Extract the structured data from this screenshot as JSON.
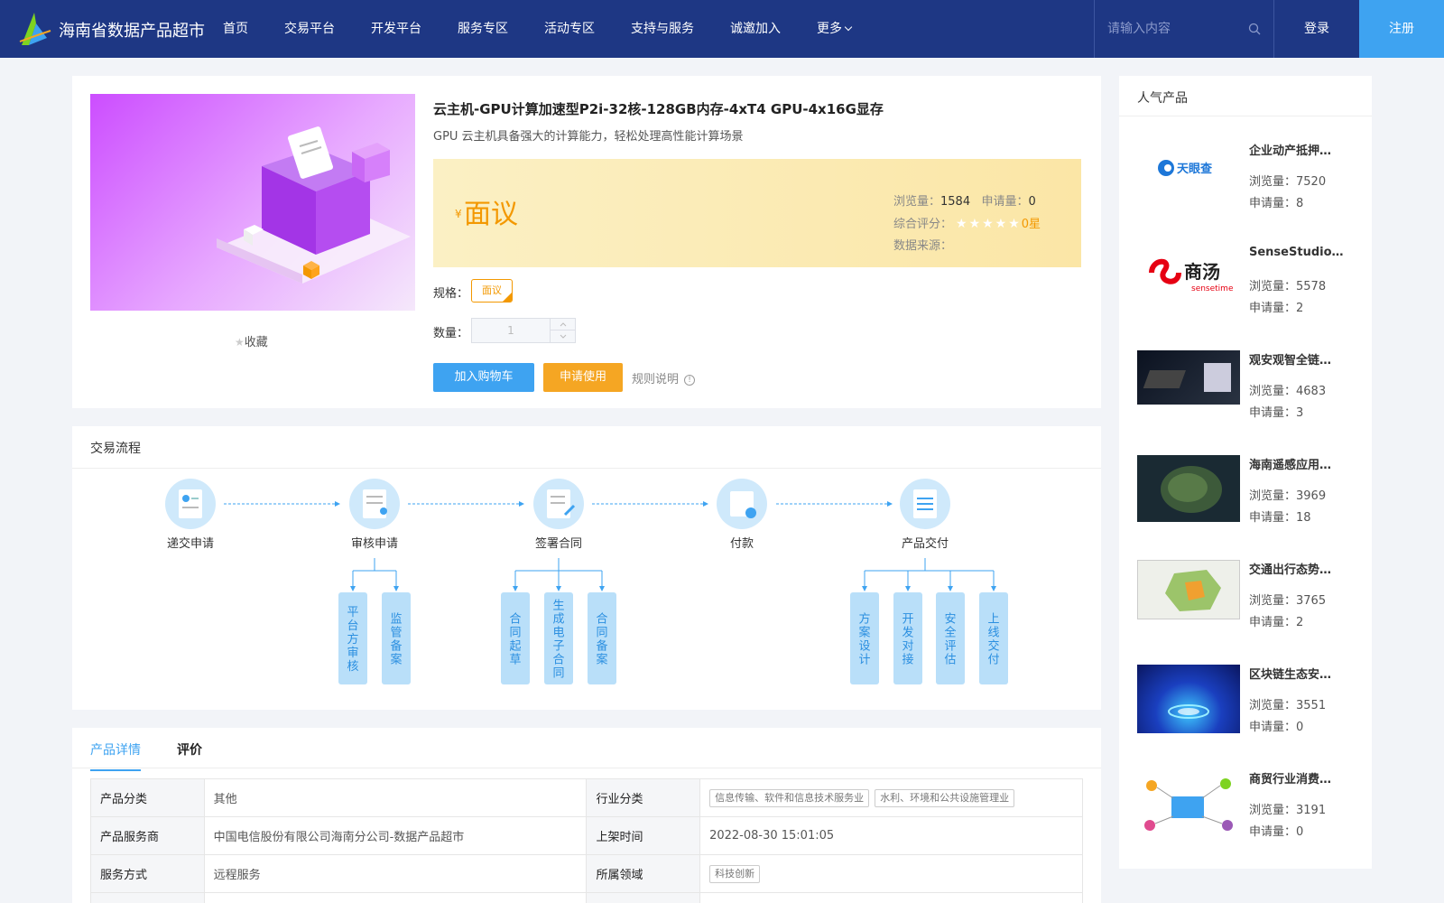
{
  "header": {
    "site_name": "海南省数据产品超市",
    "nav": [
      "首页",
      "交易平台",
      "开发平台",
      "服务专区",
      "活动专区",
      "支持与服务",
      "诚邀加入",
      "更多"
    ],
    "search_placeholder": "请输入内容",
    "login": "登录",
    "register": "注册"
  },
  "product": {
    "title": "云主机-GPU计算加速型P2i-32核-128GB内存-4xT4 GPU-4x16G显存",
    "subtitle": "GPU 云主机具备强大的计算能力，轻松处理高性能计算场景",
    "favorite": "收藏",
    "price_symbol": "¥",
    "price": "面议",
    "views_label": "浏览量：",
    "views": "1584",
    "applies_label": "申请量：",
    "applies": "0",
    "rating_label": "综合评分：",
    "rating": "0星",
    "source_label": "数据来源：",
    "spec_label": "规格：",
    "spec_value": "面议",
    "qty_label": "数量：",
    "qty_value": "1",
    "add_cart": "加入购物车",
    "apply": "申请使用",
    "rules": "规则说明"
  },
  "flow": {
    "title": "交易流程",
    "steps": [
      "递交申请",
      "审核申请",
      "签署合同",
      "付款",
      "产品交付"
    ],
    "sub_review": [
      "平台方审核",
      "监管备案"
    ],
    "sub_contract": [
      "合同起草",
      "生成电子合同",
      "合同备案"
    ],
    "sub_delivery": [
      "方案设计",
      "开发对接",
      "安全评估",
      "上线交付"
    ]
  },
  "detail": {
    "tabs": [
      "产品详情",
      "评价"
    ],
    "rows": [
      {
        "k1": "产品分类",
        "v1": "其他",
        "k2": "行业分类",
        "chips": [
          "信息传输、软件和信息技术服务业",
          "水利、环境和公共设施管理业"
        ]
      },
      {
        "k1": "产品服务商",
        "v1": "中国电信股份有限公司海南分公司-数据产品超市",
        "k2": "上架时间",
        "v2": "2022-08-30 15:01:05"
      },
      {
        "k1": "服务方式",
        "v1": "远程服务",
        "k2": "所属领域",
        "chips": [
          "科技创新"
        ]
      }
    ]
  },
  "popular": {
    "title": "人气产品",
    "views_label": "浏览量：",
    "applies_label": "申请量：",
    "items": [
      {
        "name": "企业动产抵押…",
        "views": "7520",
        "applies": "8",
        "logo_text": "天眼查"
      },
      {
        "name": "SenseStudio…",
        "views": "5578",
        "applies": "2",
        "logo_text": "商汤",
        "logo_sub": "sensetime"
      },
      {
        "name": "观安观智全链…",
        "views": "4683",
        "applies": "3"
      },
      {
        "name": "海南遥感应用…",
        "views": "3969",
        "applies": "18"
      },
      {
        "name": "交通出行态势…",
        "views": "3765",
        "applies": "2"
      },
      {
        "name": "区块链生态安…",
        "views": "3551",
        "applies": "0"
      },
      {
        "name": "商贸行业消费…",
        "views": "3191",
        "applies": "0"
      }
    ]
  },
  "colors": {
    "header": "#1e3784",
    "accent": "#3ea3f1",
    "price": "#f39800"
  }
}
